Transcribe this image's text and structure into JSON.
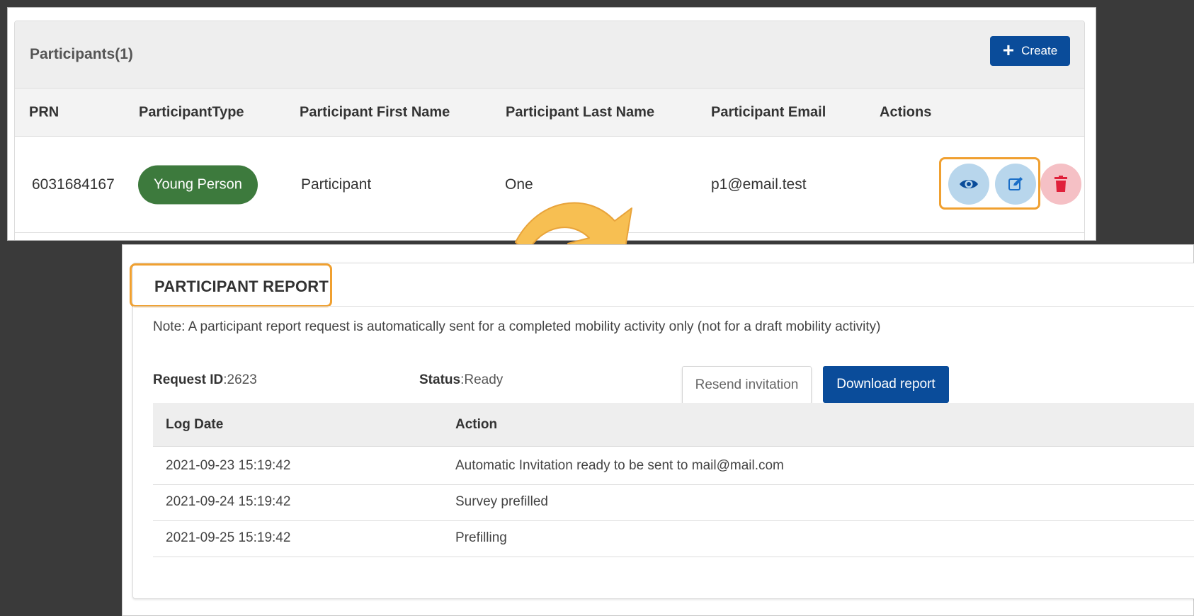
{
  "participants": {
    "title": "Participants(1)",
    "create_label": "Create",
    "columns": [
      "PRN",
      "ParticipantType",
      "Participant First Name",
      "Participant Last Name",
      "Participant Email",
      "Actions"
    ],
    "rows": [
      {
        "prn": "6031684167",
        "type": "Young Person",
        "first_name": "Participant",
        "last_name": "One",
        "email": "p1@email.test"
      }
    ]
  },
  "report": {
    "title": "PARTICIPANT REPORT",
    "note": "Note: A participant report request is automatically sent for a completed mobility activity only (not for a draft mobility activity)",
    "request_id_label": "Request ID",
    "request_id_value": ":2623",
    "status_label": "Status",
    "status_value": ":Ready",
    "resend_label": "Resend invitation",
    "download_label": "Download report",
    "log_columns": [
      "Log Date",
      "Action"
    ],
    "log_rows": [
      {
        "date": "2021-09-23 15:19:42",
        "action": "Automatic Invitation ready to be sent to mail@mail.com"
      },
      {
        "date": "2021-09-24 15:19:42",
        "action": "Survey prefilled"
      },
      {
        "date": "2021-09-25 15:19:42",
        "action": "Prefilling"
      }
    ]
  },
  "colors": {
    "primary": "#0a4c9a",
    "young_person_pill": "#3d7a3d",
    "highlight": "#f0a030",
    "delete": "#e0203a"
  },
  "icons": [
    "plus-icon",
    "eye-icon",
    "edit-icon",
    "trash-icon",
    "curved-arrow-icon"
  ]
}
